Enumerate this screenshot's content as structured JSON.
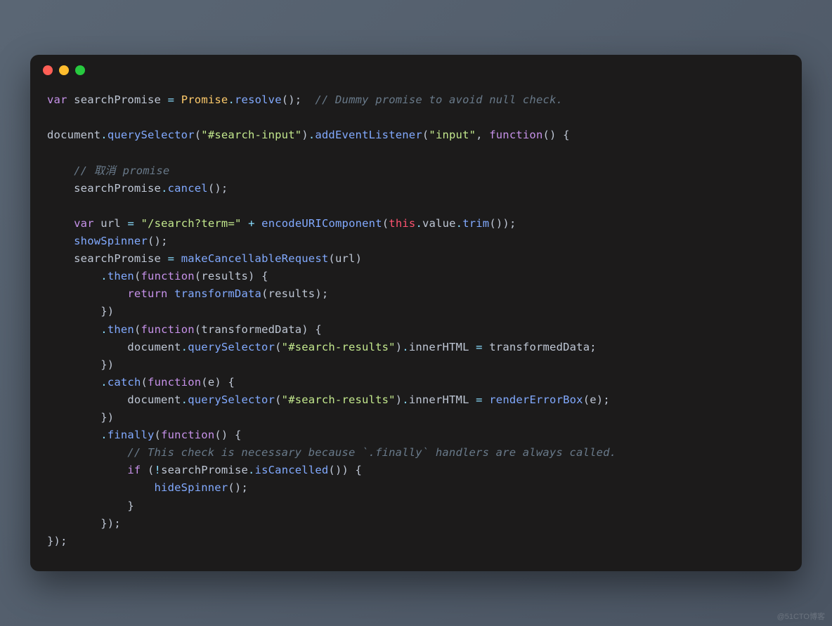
{
  "window": {
    "traffic_lights": [
      "red",
      "yellow",
      "green"
    ]
  },
  "watermark": "@51CTO博客",
  "code": {
    "tokens": [
      [
        {
          "c": "kw",
          "t": "var"
        },
        {
          "c": "pn",
          "t": " "
        },
        {
          "c": "id",
          "t": "searchPromise"
        },
        {
          "c": "pn",
          "t": " "
        },
        {
          "c": "op",
          "t": "="
        },
        {
          "c": "pn",
          "t": " "
        },
        {
          "c": "obj",
          "t": "Promise"
        },
        {
          "c": "op",
          "t": "."
        },
        {
          "c": "fn",
          "t": "resolve"
        },
        {
          "c": "pn",
          "t": "();  "
        },
        {
          "c": "cm",
          "t": "// Dummy promise to avoid null check."
        }
      ],
      [],
      [
        {
          "c": "id",
          "t": "document"
        },
        {
          "c": "op",
          "t": "."
        },
        {
          "c": "fn",
          "t": "querySelector"
        },
        {
          "c": "pn",
          "t": "("
        },
        {
          "c": "str",
          "t": "\"#search-input\""
        },
        {
          "c": "pn",
          "t": ")"
        },
        {
          "c": "op",
          "t": "."
        },
        {
          "c": "fn",
          "t": "addEventListener"
        },
        {
          "c": "pn",
          "t": "("
        },
        {
          "c": "str",
          "t": "\"input\""
        },
        {
          "c": "pn",
          "t": ", "
        },
        {
          "c": "kw",
          "t": "function"
        },
        {
          "c": "pn",
          "t": "() {"
        }
      ],
      [],
      [
        {
          "c": "pn",
          "t": "    "
        },
        {
          "c": "cm",
          "t": "// 取消 promise"
        }
      ],
      [
        {
          "c": "pn",
          "t": "    "
        },
        {
          "c": "id",
          "t": "searchPromise"
        },
        {
          "c": "op",
          "t": "."
        },
        {
          "c": "fn",
          "t": "cancel"
        },
        {
          "c": "pn",
          "t": "();"
        }
      ],
      [],
      [
        {
          "c": "pn",
          "t": "    "
        },
        {
          "c": "kw",
          "t": "var"
        },
        {
          "c": "pn",
          "t": " "
        },
        {
          "c": "id",
          "t": "url"
        },
        {
          "c": "pn",
          "t": " "
        },
        {
          "c": "op",
          "t": "="
        },
        {
          "c": "pn",
          "t": " "
        },
        {
          "c": "str",
          "t": "\"/search?term=\""
        },
        {
          "c": "pn",
          "t": " "
        },
        {
          "c": "op",
          "t": "+"
        },
        {
          "c": "pn",
          "t": " "
        },
        {
          "c": "fn",
          "t": "encodeURIComponent"
        },
        {
          "c": "pn",
          "t": "("
        },
        {
          "c": "this",
          "t": "this"
        },
        {
          "c": "op",
          "t": "."
        },
        {
          "c": "prop",
          "t": "value"
        },
        {
          "c": "op",
          "t": "."
        },
        {
          "c": "fn",
          "t": "trim"
        },
        {
          "c": "pn",
          "t": "());"
        }
      ],
      [
        {
          "c": "pn",
          "t": "    "
        },
        {
          "c": "fn",
          "t": "showSpinner"
        },
        {
          "c": "pn",
          "t": "();"
        }
      ],
      [
        {
          "c": "pn",
          "t": "    "
        },
        {
          "c": "id",
          "t": "searchPromise"
        },
        {
          "c": "pn",
          "t": " "
        },
        {
          "c": "op",
          "t": "="
        },
        {
          "c": "pn",
          "t": " "
        },
        {
          "c": "fn",
          "t": "makeCancellableRequest"
        },
        {
          "c": "pn",
          "t": "("
        },
        {
          "c": "id",
          "t": "url"
        },
        {
          "c": "pn",
          "t": ")"
        }
      ],
      [
        {
          "c": "pn",
          "t": "        "
        },
        {
          "c": "op",
          "t": "."
        },
        {
          "c": "fn",
          "t": "then"
        },
        {
          "c": "pn",
          "t": "("
        },
        {
          "c": "kw",
          "t": "function"
        },
        {
          "c": "pn",
          "t": "("
        },
        {
          "c": "id",
          "t": "results"
        },
        {
          "c": "pn",
          "t": ") {"
        }
      ],
      [
        {
          "c": "pn",
          "t": "            "
        },
        {
          "c": "kw",
          "t": "return"
        },
        {
          "c": "pn",
          "t": " "
        },
        {
          "c": "fn",
          "t": "transformData"
        },
        {
          "c": "pn",
          "t": "("
        },
        {
          "c": "id",
          "t": "results"
        },
        {
          "c": "pn",
          "t": ");"
        }
      ],
      [
        {
          "c": "pn",
          "t": "        })"
        }
      ],
      [
        {
          "c": "pn",
          "t": "        "
        },
        {
          "c": "op",
          "t": "."
        },
        {
          "c": "fn",
          "t": "then"
        },
        {
          "c": "pn",
          "t": "("
        },
        {
          "c": "kw",
          "t": "function"
        },
        {
          "c": "pn",
          "t": "("
        },
        {
          "c": "id",
          "t": "transformedData"
        },
        {
          "c": "pn",
          "t": ") {"
        }
      ],
      [
        {
          "c": "pn",
          "t": "            "
        },
        {
          "c": "id",
          "t": "document"
        },
        {
          "c": "op",
          "t": "."
        },
        {
          "c": "fn",
          "t": "querySelector"
        },
        {
          "c": "pn",
          "t": "("
        },
        {
          "c": "str",
          "t": "\"#search-results\""
        },
        {
          "c": "pn",
          "t": ")"
        },
        {
          "c": "op",
          "t": "."
        },
        {
          "c": "prop",
          "t": "innerHTML"
        },
        {
          "c": "pn",
          "t": " "
        },
        {
          "c": "op",
          "t": "="
        },
        {
          "c": "pn",
          "t": " "
        },
        {
          "c": "id",
          "t": "transformedData"
        },
        {
          "c": "pn",
          "t": ";"
        }
      ],
      [
        {
          "c": "pn",
          "t": "        })"
        }
      ],
      [
        {
          "c": "pn",
          "t": "        "
        },
        {
          "c": "op",
          "t": "."
        },
        {
          "c": "fn",
          "t": "catch"
        },
        {
          "c": "pn",
          "t": "("
        },
        {
          "c": "kw",
          "t": "function"
        },
        {
          "c": "pn",
          "t": "("
        },
        {
          "c": "id",
          "t": "e"
        },
        {
          "c": "pn",
          "t": ") {"
        }
      ],
      [
        {
          "c": "pn",
          "t": "            "
        },
        {
          "c": "id",
          "t": "document"
        },
        {
          "c": "op",
          "t": "."
        },
        {
          "c": "fn",
          "t": "querySelector"
        },
        {
          "c": "pn",
          "t": "("
        },
        {
          "c": "str",
          "t": "\"#search-results\""
        },
        {
          "c": "pn",
          "t": ")"
        },
        {
          "c": "op",
          "t": "."
        },
        {
          "c": "prop",
          "t": "innerHTML"
        },
        {
          "c": "pn",
          "t": " "
        },
        {
          "c": "op",
          "t": "="
        },
        {
          "c": "pn",
          "t": " "
        },
        {
          "c": "fn",
          "t": "renderErrorBox"
        },
        {
          "c": "pn",
          "t": "("
        },
        {
          "c": "id",
          "t": "e"
        },
        {
          "c": "pn",
          "t": ");"
        }
      ],
      [
        {
          "c": "pn",
          "t": "        })"
        }
      ],
      [
        {
          "c": "pn",
          "t": "        "
        },
        {
          "c": "op",
          "t": "."
        },
        {
          "c": "fn",
          "t": "finally"
        },
        {
          "c": "pn",
          "t": "("
        },
        {
          "c": "kw",
          "t": "function"
        },
        {
          "c": "pn",
          "t": "() {"
        }
      ],
      [
        {
          "c": "pn",
          "t": "            "
        },
        {
          "c": "cm",
          "t": "// This check is necessary because `.finally` handlers are always called."
        }
      ],
      [
        {
          "c": "pn",
          "t": "            "
        },
        {
          "c": "kw",
          "t": "if"
        },
        {
          "c": "pn",
          "t": " ("
        },
        {
          "c": "op",
          "t": "!"
        },
        {
          "c": "id",
          "t": "searchPromise"
        },
        {
          "c": "op",
          "t": "."
        },
        {
          "c": "fn",
          "t": "isCancelled"
        },
        {
          "c": "pn",
          "t": "()) {"
        }
      ],
      [
        {
          "c": "pn",
          "t": "                "
        },
        {
          "c": "fn",
          "t": "hideSpinner"
        },
        {
          "c": "pn",
          "t": "();"
        }
      ],
      [
        {
          "c": "pn",
          "t": "            }"
        }
      ],
      [
        {
          "c": "pn",
          "t": "        });"
        }
      ],
      [
        {
          "c": "pn",
          "t": "});"
        }
      ]
    ]
  }
}
